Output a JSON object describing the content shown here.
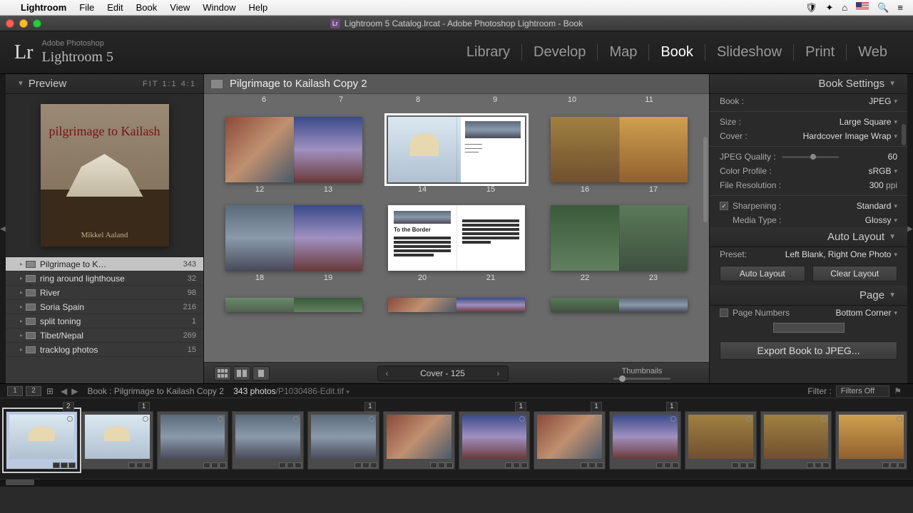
{
  "macmenu": {
    "app": "Lightroom",
    "items": [
      "File",
      "Edit",
      "Book",
      "View",
      "Window",
      "Help"
    ]
  },
  "window_title": "Lightroom 5 Catalog.lrcat - Adobe Photoshop Lightroom - Book",
  "logo": {
    "vendor": "Adobe Photoshop",
    "product": "Lightroom 5",
    "mark": "Lr"
  },
  "modules": [
    "Library",
    "Develop",
    "Map",
    "Book",
    "Slideshow",
    "Print",
    "Web"
  ],
  "active_module": "Book",
  "left": {
    "panel_title": "Preview",
    "fit_labels": "FIT   1:1   4:1",
    "cover": {
      "title": "pilgrimage to Kailash",
      "author": "Mikkel Aaland"
    },
    "collections": [
      {
        "name": "Pilgrimage to K…",
        "count": 343,
        "selected": true
      },
      {
        "name": "ring around lighthouse",
        "count": 32
      },
      {
        "name": "River",
        "count": 98
      },
      {
        "name": "Soria Spain",
        "count": 216
      },
      {
        "name": "split toning",
        "count": 1
      },
      {
        "name": "Tibet/Nepal",
        "count": 269
      },
      {
        "name": "tracklog photos",
        "count": 15
      }
    ]
  },
  "center": {
    "title": "Pilgrimage to Kailash Copy 2",
    "top_nums": [
      "6",
      "7",
      "8",
      "9",
      "10",
      "11"
    ],
    "rows": [
      [
        {
          "l": "12",
          "r": "13",
          "kind": "photo",
          "pl": "ph1",
          "pr": "ph2"
        },
        {
          "l": "14",
          "r": "15",
          "kind": "stupa",
          "selected": true
        },
        {
          "l": "16",
          "r": "17",
          "kind": "photo",
          "pl": "ph4",
          "pr": "ph5"
        }
      ],
      [
        {
          "l": "18",
          "r": "19",
          "kind": "photo",
          "pl": "ph6",
          "pr": "ph2"
        },
        {
          "l": "20",
          "r": "21",
          "kind": "text",
          "ttl": "To the Border"
        },
        {
          "l": "22",
          "r": "23",
          "kind": "photo",
          "pl": "ph7",
          "pr": "ph8"
        }
      ]
    ],
    "pager": {
      "label": "Cover - 125"
    },
    "thumb_label": "Thumbnails"
  },
  "right": {
    "header": "Book Settings",
    "book": {
      "label": "Book :",
      "value": "JPEG"
    },
    "size": {
      "label": "Size :",
      "value": "Large Square"
    },
    "cover": {
      "label": "Cover :",
      "value": "Hardcover Image Wrap"
    },
    "quality": {
      "label": "JPEG Quality :",
      "value": "60"
    },
    "profile": {
      "label": "Color Profile :",
      "value": "sRGB"
    },
    "res": {
      "label": "File Resolution :",
      "value": "300",
      "unit": "ppi"
    },
    "sharpen": {
      "label": "Sharpening :",
      "value": "Standard",
      "checked": true
    },
    "media": {
      "label": "Media Type :",
      "value": "Glossy"
    },
    "auto_layout_hdr": "Auto Layout",
    "preset": {
      "label": "Preset:",
      "value": "Left Blank, Right One Photo"
    },
    "btn_auto": "Auto Layout",
    "btn_clear": "Clear Layout",
    "page_hdr": "Page",
    "page_numbers_label": "Page Numbers",
    "page_numbers_value": "Bottom Corner",
    "export": "Export Book to JPEG..."
  },
  "filmstrip": {
    "window_1": "1",
    "window_2": "2",
    "path_prefix": "Book : ",
    "path": "Pilgrimage to Kailash Copy 2",
    "count": "343 photos",
    "current": "/P1030486-Edit.tif",
    "filter_label": "Filter :",
    "filter_value": "Filters Off",
    "thumbs": [
      {
        "badge": "2",
        "sel": true,
        "cls": "ph3"
      },
      {
        "badge": "1",
        "cls": "ph3"
      },
      {
        "cls": "ph6"
      },
      {
        "cls": "ph6"
      },
      {
        "badge": "1",
        "cls": "ph6"
      },
      {
        "cls": "ph1"
      },
      {
        "badge": "1",
        "cls": "ph2"
      },
      {
        "badge": "1",
        "cls": "ph1"
      },
      {
        "badge": "1",
        "cls": "ph2"
      },
      {
        "cls": "ph4"
      },
      {
        "cls": "ph4"
      },
      {
        "cls": "ph5"
      }
    ]
  }
}
